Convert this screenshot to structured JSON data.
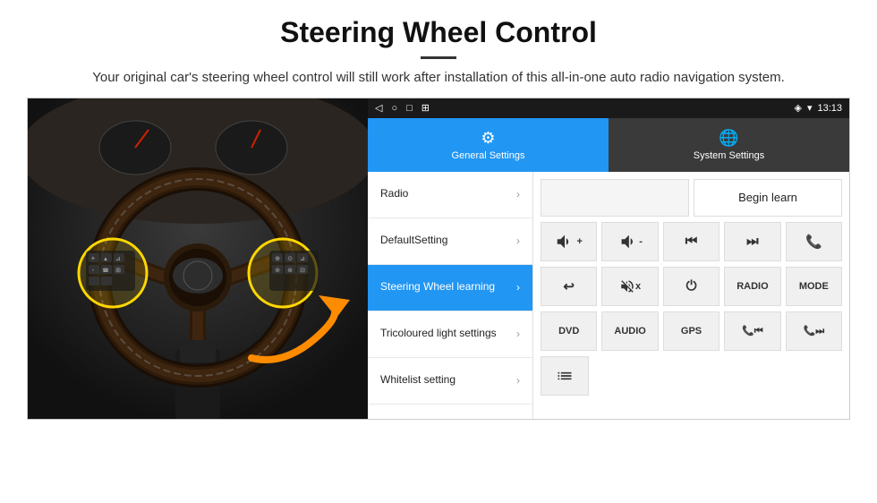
{
  "header": {
    "title": "Steering Wheel Control",
    "divider": true,
    "description": "Your original car's steering wheel control will still work after installation of this all-in-one auto radio navigation system."
  },
  "status_bar": {
    "nav_icons": [
      "◁",
      "○",
      "□",
      "⊞"
    ],
    "right_icons": [
      "◈",
      "▾",
      "13:13"
    ]
  },
  "tabs": [
    {
      "label": "General Settings",
      "icon": "⚙",
      "active": true
    },
    {
      "label": "System Settings",
      "icon": "🌐",
      "active": false
    }
  ],
  "menu_items": [
    {
      "label": "Radio",
      "active": false
    },
    {
      "label": "DefaultSetting",
      "active": false
    },
    {
      "label": "Steering Wheel learning",
      "active": true
    },
    {
      "label": "Tricoloured light settings",
      "active": false
    },
    {
      "label": "Whitelist setting",
      "active": false
    }
  ],
  "controls": {
    "begin_learn": "Begin learn",
    "row1": [
      "🔊+",
      "🔊-",
      "⏮",
      "⏭",
      "📞"
    ],
    "row2": [
      "↩",
      "🔊x",
      "⏻",
      "RADIO",
      "MODE"
    ],
    "row3": [
      "DVD",
      "AUDIO",
      "GPS",
      "📞⏮",
      "📞⏭"
    ],
    "row4": [
      "≡"
    ]
  }
}
